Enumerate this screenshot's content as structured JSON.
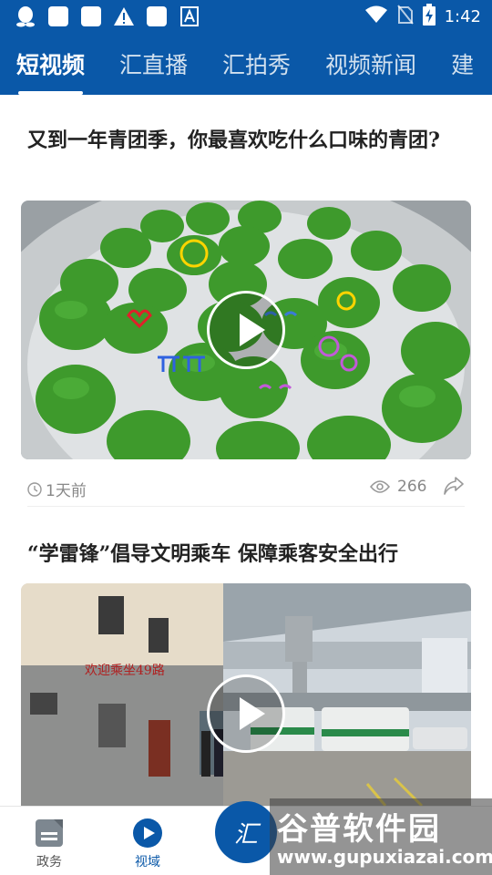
{
  "status_bar": {
    "time": "1:42",
    "left_icons": [
      "qq-penguin-icon",
      "app-square-icon",
      "app-square-icon",
      "warning-icon",
      "app-square-icon",
      "font-a-icon"
    ],
    "right_icons": [
      "wifi-icon",
      "no-sim-icon",
      "battery-charging-icon"
    ]
  },
  "tabs": [
    {
      "label": "短视频",
      "active": true
    },
    {
      "label": "汇直播",
      "active": false
    },
    {
      "label": "汇拍秀",
      "active": false
    },
    {
      "label": "视频新闻",
      "active": false
    },
    {
      "label": "建",
      "active": false
    }
  ],
  "articles": [
    {
      "title": "又到一年青团季，你最喜欢吃什么口味的青团?",
      "time": "1天前",
      "views": "266"
    },
    {
      "title": "“学雷锋”倡导文明乘车 保障乘客安全出行"
    }
  ],
  "bottom_nav": {
    "items": [
      {
        "label": "政务",
        "icon": "document-icon"
      },
      {
        "label": "视域",
        "icon": "play-circle-icon",
        "active": true
      }
    ],
    "center_label": "汇"
  },
  "watermark": {
    "title": "谷普软件园",
    "url": "www.gupuxiazai.com"
  },
  "colors": {
    "brand_blue": "#0a58a8",
    "text_dark": "#222222",
    "text_muted": "#888888"
  }
}
